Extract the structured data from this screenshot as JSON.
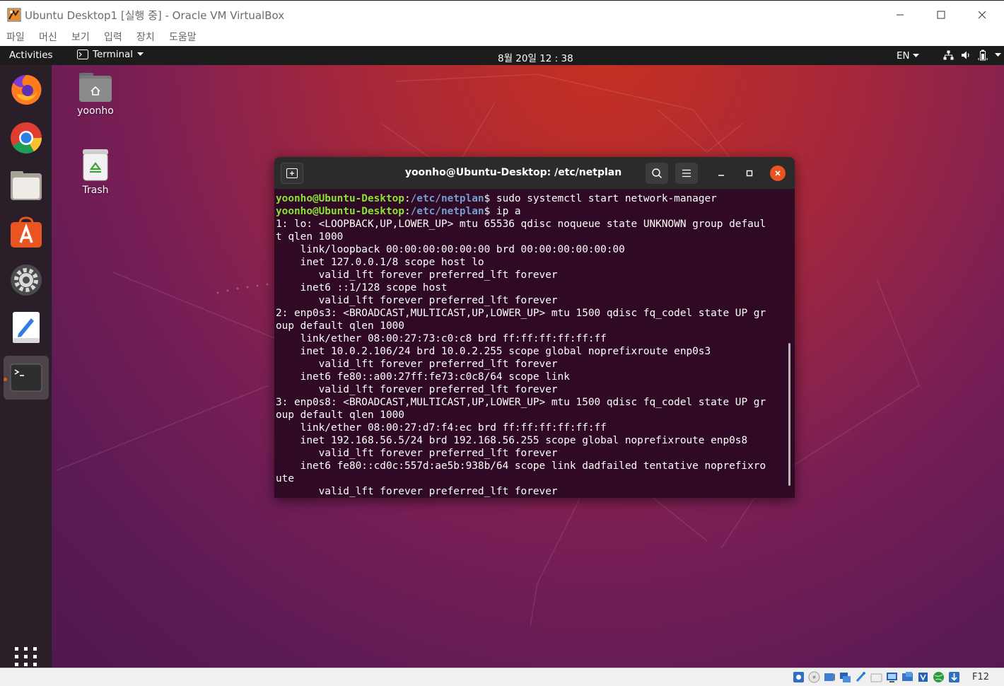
{
  "host_window": {
    "title": "Ubuntu Desktop1 [실행 중] - Oracle VM VirtualBox",
    "menu": [
      "파일",
      "머신",
      "보기",
      "입력",
      "장치",
      "도움말"
    ]
  },
  "topbar": {
    "activities": "Activities",
    "app_menu": "Terminal",
    "clock": "8월 20일  12 : 38",
    "input_lang": "EN"
  },
  "dock": {
    "items": [
      "firefox",
      "chrome",
      "files",
      "ubuntu-software",
      "settings",
      "text-editor",
      "terminal"
    ],
    "active": "terminal"
  },
  "desktop_icons": [
    {
      "label": "yoonho",
      "icon": "home-folder-icon"
    },
    {
      "label": "Trash",
      "icon": "trash-icon"
    }
  ],
  "terminal": {
    "title": "yoonho@Ubuntu-Desktop: /etc/netplan",
    "prompt_user": "yoonho@Ubuntu-Desktop",
    "prompt_path": "/etc/netplan",
    "commands": [
      "sudo systemctl start network-manager",
      "ip a"
    ],
    "output": [
      "1: lo: <LOOPBACK,UP,LOWER_UP> mtu 65536 qdisc noqueue state UNKNOWN group defaul",
      "t qlen 1000",
      "    link/loopback 00:00:00:00:00:00 brd 00:00:00:00:00:00",
      "    inet 127.0.0.1/8 scope host lo",
      "       valid_lft forever preferred_lft forever",
      "    inet6 ::1/128 scope host",
      "       valid_lft forever preferred_lft forever",
      "2: enp0s3: <BROADCAST,MULTICAST,UP,LOWER_UP> mtu 1500 qdisc fq_codel state UP gr",
      "oup default qlen 1000",
      "    link/ether 08:00:27:73:c0:c8 brd ff:ff:ff:ff:ff:ff",
      "    inet 10.0.2.106/24 brd 10.0.2.255 scope global noprefixroute enp0s3",
      "       valid_lft forever preferred_lft forever",
      "    inet6 fe80::a00:27ff:fe73:c0c8/64 scope link",
      "       valid_lft forever preferred_lft forever",
      "3: enp0s8: <BROADCAST,MULTICAST,UP,LOWER_UP> mtu 1500 qdisc fq_codel state UP gr",
      "oup default qlen 1000",
      "    link/ether 08:00:27:d7:f4:ec brd ff:ff:ff:ff:ff:ff",
      "    inet 192.168.56.5/24 brd 192.168.56.255 scope global noprefixroute enp0s8",
      "       valid_lft forever preferred_lft forever",
      "    inet6 fe80::cd0c:557d:ae5b:938b/64 scope link dadfailed tentative noprefixro",
      "ute",
      "       valid_lft forever preferred_lft forever"
    ]
  },
  "statusbar": {
    "host_key": "F12"
  },
  "colors": {
    "ubuntu_orange": "#e95420",
    "terminal_bg": "#300a24",
    "prompt_user": "#8ae234",
    "prompt_path": "#729fcf"
  }
}
